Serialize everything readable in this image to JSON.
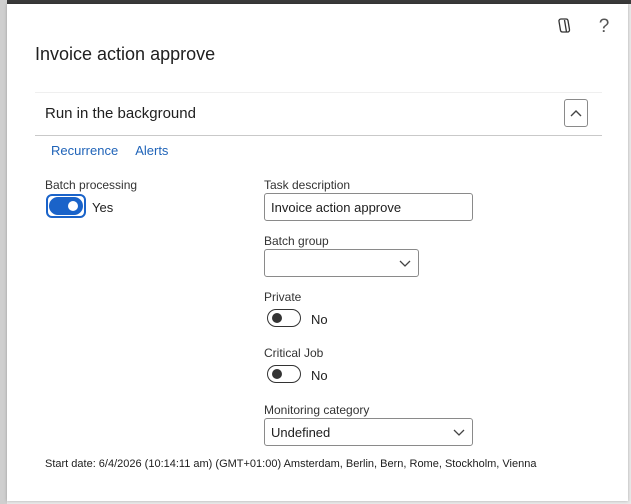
{
  "dialog": {
    "title": "Invoice action approve"
  },
  "icons": {
    "copilot": "copilot-icon",
    "help": "help-icon",
    "help_glyph": "?"
  },
  "section": {
    "title": "Run in the background",
    "tabs": [
      {
        "label": "Recurrence"
      },
      {
        "label": "Alerts"
      }
    ]
  },
  "fields": {
    "batch_processing": {
      "label": "Batch processing",
      "state": "Yes"
    },
    "task_description": {
      "label": "Task description",
      "value": "Invoice action approve"
    },
    "batch_group": {
      "label": "Batch group",
      "value": ""
    },
    "private": {
      "label": "Private",
      "state": "No"
    },
    "critical_job": {
      "label": "Critical Job",
      "state": "No"
    },
    "monitoring_category": {
      "label": "Monitoring category",
      "value": "Undefined"
    }
  },
  "footer": {
    "start_date": "Start date: 6/4/2026 (10:14:11 am) (GMT+01:00) Amsterdam, Berlin, Bern, Rome, Stockholm, Vienna"
  },
  "colors": {
    "accent": "#1a63c9",
    "link": "#1f63b8"
  }
}
